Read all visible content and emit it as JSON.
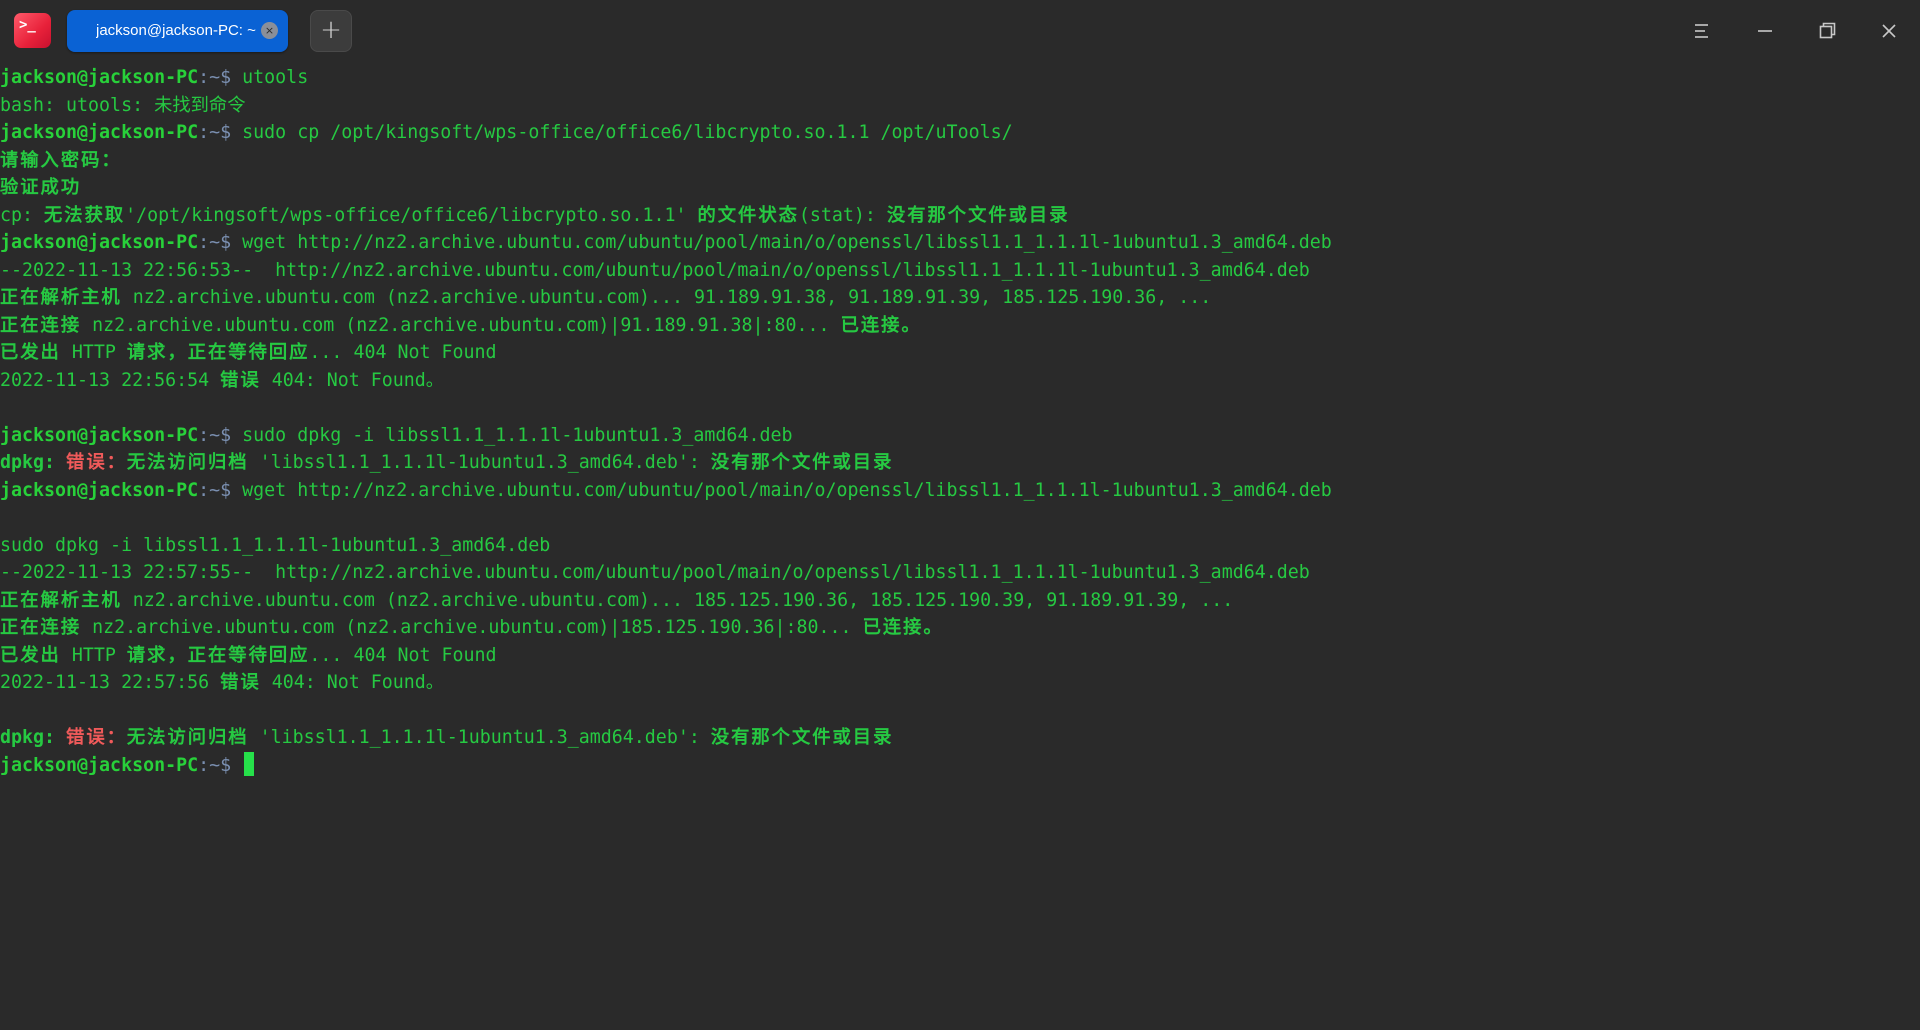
{
  "titlebar": {
    "app_icon_glyph": ">_",
    "tab_title": "jackson@jackson-PC: ~",
    "tab_close_glyph": "×",
    "new_tab_glyph": "+",
    "icons": [
      "terminal-app-icon",
      "close-icon",
      "plus-icon",
      "menu-icon",
      "minimize-icon",
      "maximize-icon",
      "close-icon"
    ]
  },
  "colors": {
    "background": "#2a2a2a",
    "text_green": "#26c942",
    "prompt_green": "#28d13a",
    "error_red": "#f05a5a",
    "tab_active": "#0a62d4"
  },
  "terminal": {
    "prompt_user": "jackson@jackson-PC",
    "prompt_path": ":~$",
    "lines": {
      "l1_cmd": " utools",
      "l2": "bash: utools: 未找到命令",
      "l3_cmd": " sudo cp /opt/kingsoft/wps-office/office6/libcrypto.so.1.1 /opt/uTools/",
      "l4": "请输入密码：",
      "l5": "验证成功",
      "l6a": "cp: ",
      "l6b": "无法获取",
      "l6c": "'/opt/kingsoft/wps-office/office6/libcrypto.so.1.1' ",
      "l6d": "的文件状态",
      "l6e": "(stat): ",
      "l6f": "没有那个文件或目录",
      "l7_cmd": " wget http://nz2.archive.ubuntu.com/ubuntu/pool/main/o/openssl/libssl1.1_1.1.1l-1ubuntu1.3_amd64.deb",
      "l8": "--2022-11-13 22:56:53--  http://nz2.archive.ubuntu.com/ubuntu/pool/main/o/openssl/libssl1.1_1.1.1l-1ubuntu1.3_amd64.deb",
      "l9a": "正在解析主机",
      "l9b": " nz2.archive.ubuntu.com (nz2.archive.ubuntu.com)... 91.189.91.38, 91.189.91.39, 185.125.190.36, ...",
      "l10a": "正在连接",
      "l10b": " nz2.archive.ubuntu.com (nz2.archive.ubuntu.com)|91.189.91.38|:80... ",
      "l10c": "已连接。",
      "l11a": "已发出",
      "l11b": " HTTP ",
      "l11c": "请求，正在等待回应",
      "l11d": "... 404 Not Found",
      "l12a": "2022-11-13 22:56:54 ",
      "l12b": "错误",
      "l12c": " 404: Not Found。",
      "l14_cmd": " sudo dpkg -i libssl1.1_1.1.1l-1ubuntu1.3_amd64.deb",
      "l15a": "dpkg: ",
      "l15b": "错误：",
      "l15c": "无法访问归档",
      "l15d": " 'libssl1.1_1.1.1l-1ubuntu1.3_amd64.deb': ",
      "l15e": "没有那个文件或目录",
      "l16_cmd": " wget http://nz2.archive.ubuntu.com/ubuntu/pool/main/o/openssl/libssl1.1_1.1.1l-1ubuntu1.3_amd64.deb",
      "l18": "sudo dpkg -i libssl1.1_1.1.1l-1ubuntu1.3_amd64.deb",
      "l19": "--2022-11-13 22:57:55--  http://nz2.archive.ubuntu.com/ubuntu/pool/main/o/openssl/libssl1.1_1.1.1l-1ubuntu1.3_amd64.deb",
      "l20a": "正在解析主机",
      "l20b": " nz2.archive.ubuntu.com (nz2.archive.ubuntu.com)... 185.125.190.36, 185.125.190.39, 91.189.91.39, ...",
      "l21a": "正在连接",
      "l21b": " nz2.archive.ubuntu.com (nz2.archive.ubuntu.com)|185.125.190.36|:80... ",
      "l21c": "已连接。",
      "l22a": "已发出",
      "l22b": " HTTP ",
      "l22c": "请求，正在等待回应",
      "l22d": "... 404 Not Found",
      "l23a": "2022-11-13 22:57:56 ",
      "l23b": "错误",
      "l23c": " 404: Not Found。",
      "l25a": "dpkg: ",
      "l25b": "错误：",
      "l25c": "无法访问归档",
      "l25d": " 'libssl1.1_1.1.1l-1ubuntu1.3_amd64.deb': ",
      "l25e": "没有那个文件或目录",
      "l26_cmd": " "
    }
  }
}
